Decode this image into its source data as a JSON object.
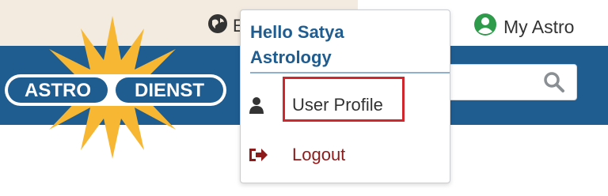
{
  "topbar": {
    "language_label_partial": "E",
    "my_astro_label": "My Astro"
  },
  "logo": {
    "left_text": "ASTRO",
    "right_text": "DIENST"
  },
  "search": {
    "placeholder": ""
  },
  "dropdown": {
    "greeting": "Hello Satya Astrology",
    "items": [
      {
        "label": "User Profile",
        "icon": "user-icon"
      },
      {
        "label": "Logout",
        "icon": "logout-icon"
      }
    ]
  },
  "colors": {
    "brand_blue": "#1f5d91",
    "topbar_bg": "#f3ebe0",
    "star_yellow": "#f7b733",
    "green_avatar": "#2e9b4a",
    "logout_red": "#8e1b1b",
    "highlight_red": "#d0272f"
  }
}
